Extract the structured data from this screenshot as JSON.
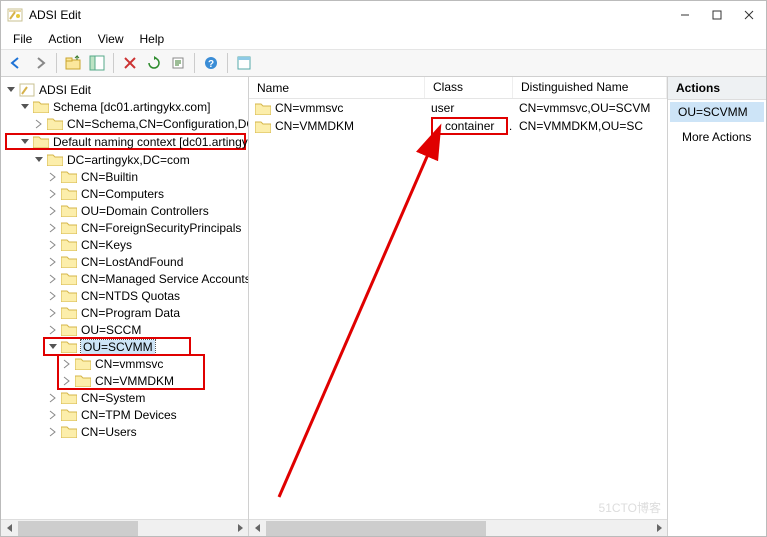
{
  "app": {
    "title": "ADSI Edit"
  },
  "menu": {
    "file": "File",
    "action": "Action",
    "view": "View",
    "help": "Help"
  },
  "tree": {
    "root": "ADSI Edit",
    "schema": "Schema [dc01.artingykx.com]",
    "schema_child": "CN=Schema,CN=Configuration,DC",
    "default_ctx": "Default naming context [dc01.artingykx",
    "dc": "DC=artingykx,DC=com",
    "children": {
      "builtin": "CN=Builtin",
      "computers": "CN=Computers",
      "domain_controllers": "OU=Domain Controllers",
      "fsp": "CN=ForeignSecurityPrincipals",
      "keys": "CN=Keys",
      "lost": "CN=LostAndFound",
      "msa": "CN=Managed Service Accounts",
      "ntds": "CN=NTDS Quotas",
      "progdata": "CN=Program Data",
      "sccm": "OU=SCCM",
      "scvmm": "OU=SCVMM",
      "vmmsvc": "CN=vmmsvc",
      "vmmdkm": "CN=VMMDKM",
      "system": "CN=System",
      "tpm": "CN=TPM Devices",
      "users": "CN=Users"
    }
  },
  "list": {
    "columns": {
      "name": "Name",
      "class": "Class",
      "dn": "Distinguished Name"
    },
    "rows": [
      {
        "name": "CN=vmmsvc",
        "class": "user",
        "dn": "CN=vmmsvc,OU=SCVM"
      },
      {
        "name": "CN=VMMDKM",
        "class": "container",
        "dn": "CN=VMMDKM,OU=SC"
      }
    ]
  },
  "actions": {
    "header": "Actions",
    "selected": "OU=SCVMM",
    "more": "More Actions"
  },
  "watermark": "51CTO博客"
}
